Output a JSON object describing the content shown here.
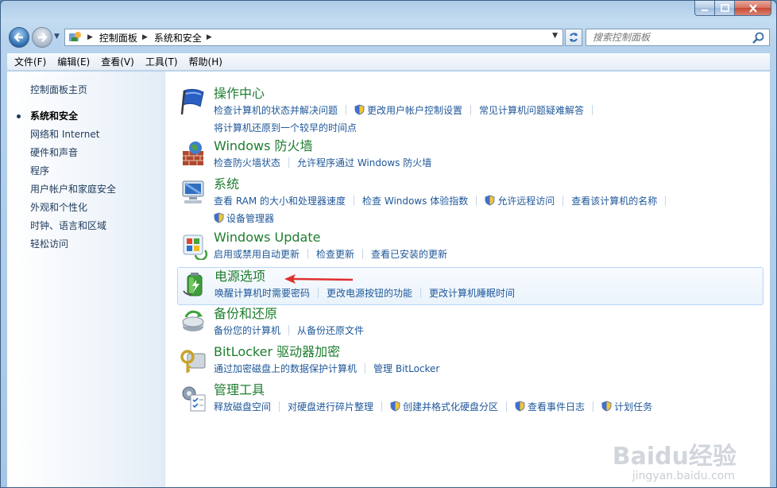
{
  "window": {
    "caption_buttons": [
      "minimize",
      "maximize",
      "close"
    ]
  },
  "address_bar": {
    "breadcrumbs": [
      "控制面板",
      "系统和安全"
    ]
  },
  "search": {
    "placeholder": "搜索控制面板"
  },
  "menubar": [
    "文件(F)",
    "编辑(E)",
    "查看(V)",
    "工具(T)",
    "帮助(H)"
  ],
  "sidebar": {
    "home": "控制面板主页",
    "items": [
      {
        "label": "系统和安全",
        "current": true
      },
      {
        "label": "网络和 Internet"
      },
      {
        "label": "硬件和声音"
      },
      {
        "label": "程序"
      },
      {
        "label": "用户帐户和家庭安全"
      },
      {
        "label": "外观和个性化"
      },
      {
        "label": "时钟、语言和区域"
      },
      {
        "label": "轻松访问"
      }
    ]
  },
  "categories": [
    {
      "title": "操作中心",
      "icon": "action-center-flag-icon",
      "links": [
        "检查计算机的状态并解决问题",
        "更改用户帐户控制设置",
        "常见计算机问题疑难解答",
        "将计算机还原到一个较早的时间点"
      ]
    },
    {
      "title": "Windows 防火墙",
      "icon": "firewall-icon",
      "links": [
        "检查防火墙状态",
        "允许程序通过 Windows 防火墙"
      ]
    },
    {
      "title": "系统",
      "icon": "system-computer-icon",
      "links": [
        "查看 RAM 的大小和处理器速度",
        "检查 Windows 体验指数",
        "允许远程访问",
        "查看该计算机的名称",
        "设备管理器"
      ]
    },
    {
      "title": "Windows Update",
      "icon": "windows-update-icon",
      "links": [
        "启用或禁用自动更新",
        "检查更新",
        "查看已安装的更新"
      ]
    },
    {
      "title": "电源选项",
      "icon": "power-options-battery-icon",
      "links": [
        "唤醒计算机时需要密码",
        "更改电源按钮的功能",
        "更改计算机睡眠时间"
      ]
    },
    {
      "title": "备份和还原",
      "icon": "backup-restore-icon",
      "links": [
        "备份您的计算机",
        "从备份还原文件"
      ]
    },
    {
      "title": "BitLocker 驱动器加密",
      "icon": "bitlocker-key-icon",
      "links": [
        "通过加密磁盘上的数据保护计算机",
        "管理 BitLocker"
      ]
    },
    {
      "title": "管理工具",
      "icon": "admin-tools-icon",
      "links": [
        "释放磁盘空间",
        "对硬盘进行碎片整理",
        "创建并格式化硬盘分区",
        "查看事件日志",
        "计划任务"
      ]
    }
  ],
  "watermark": {
    "text": "Baidu经验",
    "sub": "jingyan.baidu.com"
  },
  "colors": {
    "category_title": "#1e7d2f",
    "link": "#1e5799",
    "highlight_border": "#b8d6fb",
    "arrow": "#e03030"
  }
}
